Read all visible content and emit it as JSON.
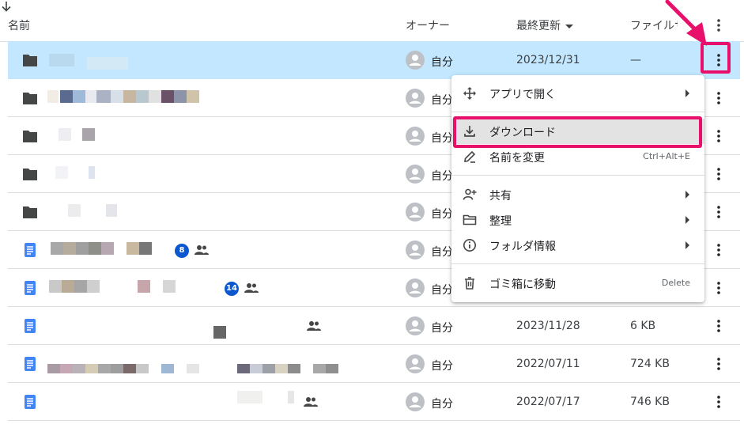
{
  "header": {
    "name": "名前",
    "owner": "オーナー",
    "modified": "最終更新",
    "size": "ファイルサイ"
  },
  "rows": [
    {
      "type": "folder",
      "owner": "自分",
      "modified": "2023/12/31",
      "size": "—",
      "selected": true
    },
    {
      "type": "folder",
      "owner": "自分",
      "modified": "",
      "size": ""
    },
    {
      "type": "folder",
      "owner": "自分",
      "modified": "",
      "size": ""
    },
    {
      "type": "folder",
      "owner": "自分",
      "modified": "",
      "size": ""
    },
    {
      "type": "folder",
      "owner": "自分",
      "modified": "",
      "size": ""
    },
    {
      "type": "doc",
      "owner": "自分",
      "modified": "",
      "size": "",
      "badge": "8",
      "shared": true
    },
    {
      "type": "doc",
      "owner": "自分",
      "modified": "",
      "size": "",
      "badge": "14",
      "shared": true
    },
    {
      "type": "doc",
      "owner": "自分",
      "modified": "2023/11/28",
      "size": "6 KB",
      "shared": true
    },
    {
      "type": "doc",
      "owner": "自分",
      "modified": "2022/07/11",
      "size": "724 KB"
    },
    {
      "type": "doc",
      "owner": "自分",
      "modified": "2022/07/17",
      "size": "746 KB",
      "shared": true
    }
  ],
  "menu": {
    "open_with": "アプリで開く",
    "download": "ダウンロード",
    "rename": "名前を変更",
    "rename_shortcut": "Ctrl+Alt+E",
    "share": "共有",
    "organize": "整理",
    "folder_info": "フォルダ情報",
    "trash": "ゴミ箱に移動",
    "trash_shortcut": "Delete"
  },
  "colors": {
    "selected_row": "#c2e7ff",
    "highlight": "#e8106b",
    "doc_icon": "#4285f4",
    "folder_icon": "#444746",
    "badge": "#0b57d0"
  }
}
